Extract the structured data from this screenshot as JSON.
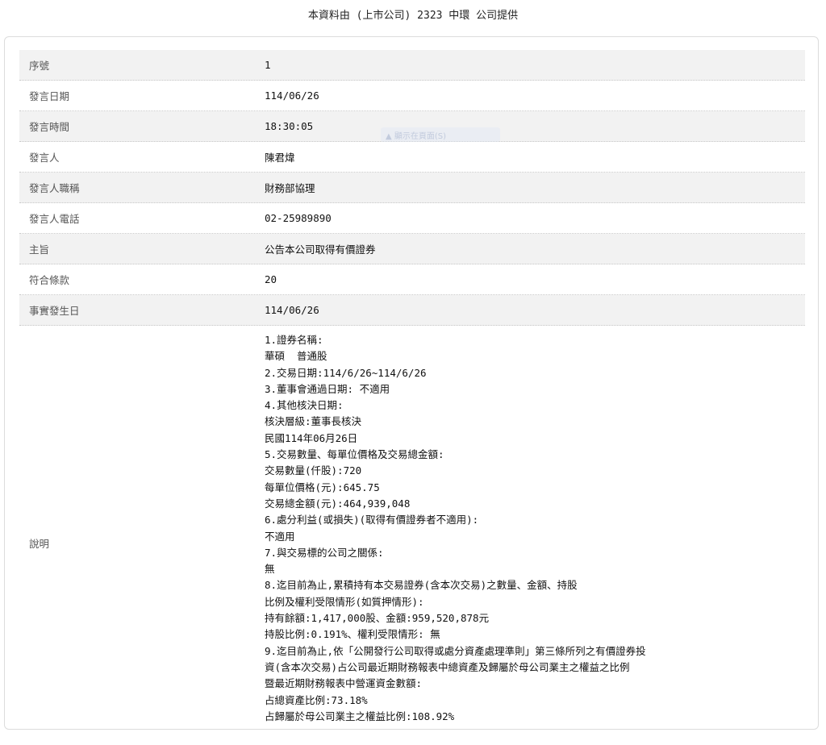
{
  "header": {
    "title": "本資料由 (上市公司) 2323 中環 公司提供"
  },
  "overlay": {
    "text": "▲ 顯示在頁面(S)"
  },
  "rows": [
    {
      "label": "序號",
      "value": "1"
    },
    {
      "label": "發言日期",
      "value": "114/06/26"
    },
    {
      "label": "發言時間",
      "value": "18:30:05"
    },
    {
      "label": "發言人",
      "value": "陳君煒"
    },
    {
      "label": "發言人職稱",
      "value": "財務部協理"
    },
    {
      "label": "發言人電話",
      "value": "02-25989890"
    },
    {
      "label": "主旨",
      "value": "公告本公司取得有價證券"
    },
    {
      "label": "符合條款",
      "value": "20"
    },
    {
      "label": "事實發生日",
      "value": "114/06/26"
    }
  ],
  "description": {
    "label": "說明",
    "lines": [
      "1.證券名稱:",
      "華碩  普通股",
      "2.交易日期:114/6/26~114/6/26",
      "3.董事會通過日期: 不適用",
      "4.其他核決日期:",
      "核決層級:董事長核決",
      "民國114年06月26日",
      "5.交易數量、每單位價格及交易總金額:",
      "交易數量(仟股):720",
      "每單位價格(元):645.75",
      "交易總金額(元):464,939,048",
      "6.處分利益(或損失)(取得有價證券者不適用):",
      "不適用",
      "7.與交易標的公司之關係:",
      "無",
      "8.迄目前為止,累積持有本交易證券(含本次交易)之數量、金額、持股",
      "比例及權利受限情形(如質押情形):",
      "持有餘額:1,417,000股、金額:959,520,878元",
      "持股比例:0.191%、權利受限情形: 無",
      "9.迄目前為止,依「公開發行公司取得或處分資產處理準則」第三條所列之有價證券投",
      "資(含本次交易)占公司最近期財務報表中總資產及歸屬於母公司業主之權益之比例",
      "暨最近期財務報表中營運資金數額:",
      "占總資產比例:73.18%",
      "占歸屬於母公司業主之權益比例:108.92%"
    ]
  }
}
